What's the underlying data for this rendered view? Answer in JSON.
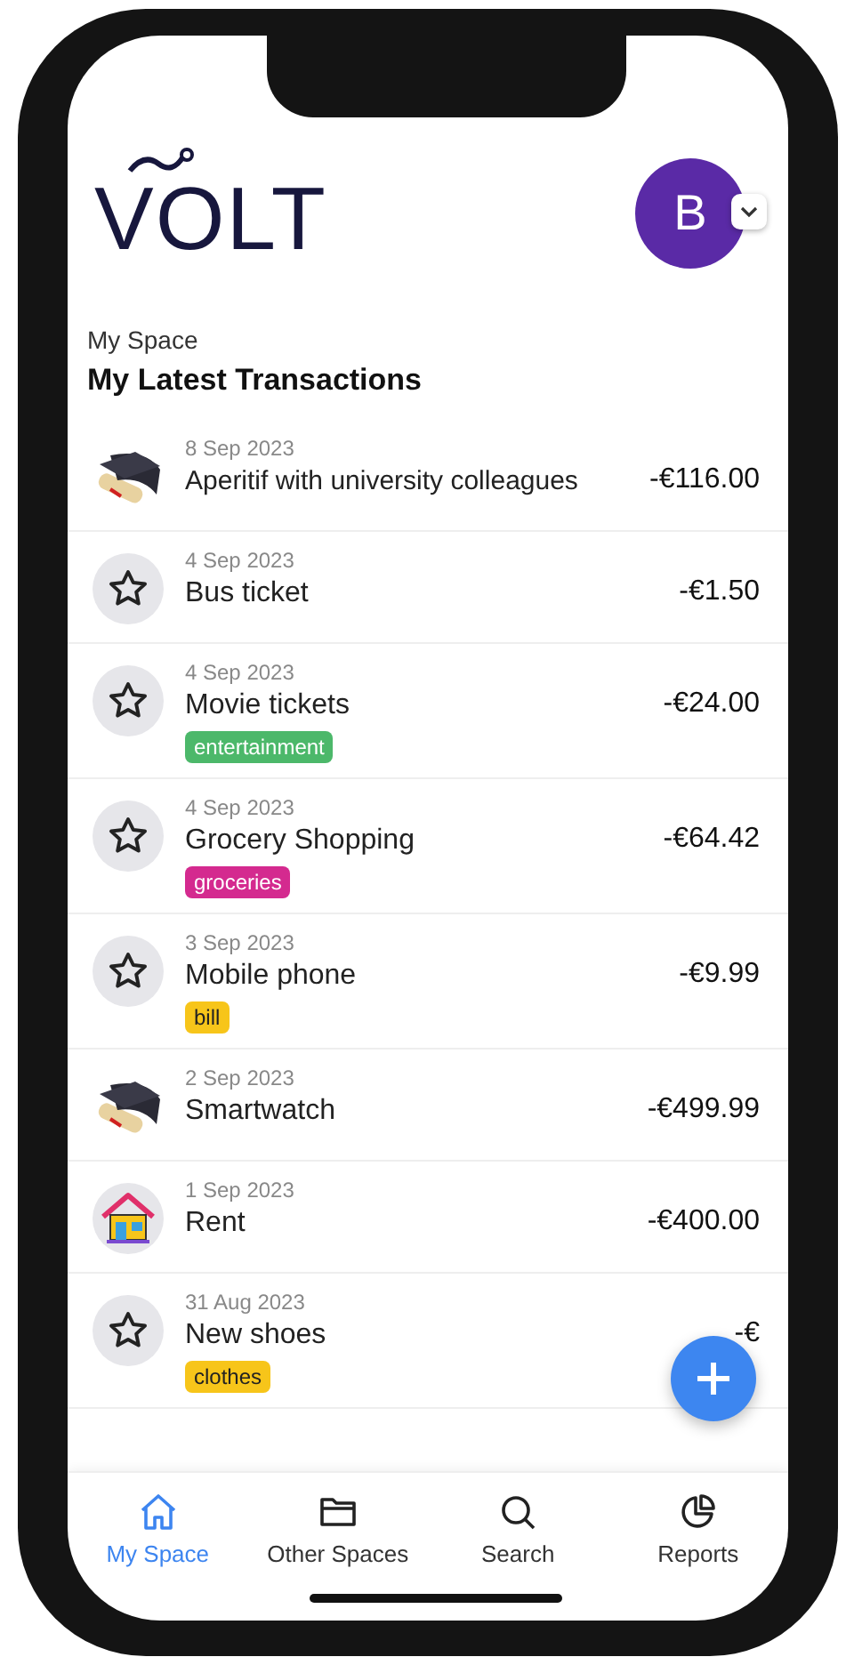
{
  "logo": "VOLT",
  "profile": {
    "initial": "B"
  },
  "section": {
    "space": "My Space",
    "title": "My Latest Transactions"
  },
  "transactions": [
    {
      "date": "8 Sep 2023",
      "title": "Aperitif with university colleagues",
      "amount": "-€116.00",
      "kind": "cap"
    },
    {
      "date": "4 Sep 2023",
      "title": "Bus ticket",
      "amount": "-€1.50",
      "kind": "star"
    },
    {
      "date": "4 Sep 2023",
      "title": "Movie tickets",
      "amount": "-€24.00",
      "kind": "star",
      "tag": {
        "label": "entertainment",
        "color": "#4cb86a"
      }
    },
    {
      "date": "4 Sep 2023",
      "title": "Grocery Shopping",
      "amount": "-€64.42",
      "kind": "star",
      "tag": {
        "label": "groceries",
        "color": "#d42a8f"
      }
    },
    {
      "date": "3 Sep 2023",
      "title": "Mobile phone",
      "amount": "-€9.99",
      "kind": "star",
      "tag": {
        "label": "bill",
        "color": "#f7c51a"
      }
    },
    {
      "date": "2 Sep 2023",
      "title": "Smartwatch",
      "amount": "-€499.99",
      "kind": "cap"
    },
    {
      "date": "1 Sep 2023",
      "title": "Rent",
      "amount": "-€400.00",
      "kind": "house"
    },
    {
      "date": "31 Aug 2023",
      "title": "New shoes",
      "amount": "-€",
      "kind": "star",
      "tag": {
        "label": "clothes",
        "color": "#f7c51a"
      }
    }
  ],
  "nav": [
    {
      "label": "My Space",
      "kind": "home",
      "selected": true
    },
    {
      "label": "Other Spaces",
      "kind": "folder",
      "selected": false
    },
    {
      "label": "Search",
      "kind": "search",
      "selected": false
    },
    {
      "label": "Reports",
      "kind": "pie",
      "selected": false
    }
  ]
}
